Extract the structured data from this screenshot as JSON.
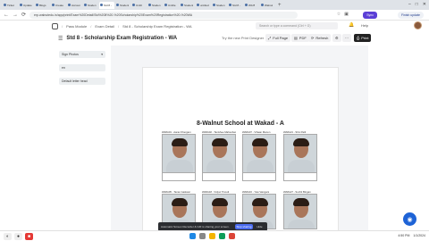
{
  "browser": {
    "tabs": [
      "Ticket",
      "Update",
      "Blogs",
      "Create",
      "Accoun",
      "Studen",
      "Std 8 -",
      "Student",
      "Untitl",
      "Studen",
      "Untitle",
      "Student",
      "untitled",
      "Studen",
      "Std 8 -",
      "WA B",
      "Walnut"
    ],
    "active_tab_index": 6,
    "url": "erp.walnutedu.in/app/print/Exam%20Detail/Std%208%20-%20Scholarship%20Exam%20Registration%20-%20WA",
    "sync_label": "Sync",
    "update_label": "Finish update"
  },
  "app_header": {
    "crumbs": [
      "Pass Module",
      "Exam Detail",
      "Std 8 - Scholarship Exam Registration - WA"
    ],
    "search_placeholder": "Search or type a command (Ctrl + G)",
    "help_label": "Help"
  },
  "title_bar": {
    "title": "Std 8 - Scholarship Exam Registration - WA",
    "try_view": "Try the new Print Designer",
    "full_page": "Full Page",
    "pdf": "PDF",
    "refresh": "Refresh",
    "print": "Print"
  },
  "side_panel": {
    "format": "Sign Photos",
    "language": "en",
    "letter_head": "Default letter head"
  },
  "document": {
    "school_title": "8-Walnut School at Wakad - A",
    "students_top": [
      {
        "caption": "WA8A01 - Aarav Khergam"
      },
      {
        "caption": "WA8A02 - Tanishee Maheshwar"
      },
      {
        "caption": "WA8A07 - Vihaan Manon"
      },
      {
        "caption": "WA8A21 - Shiv Patil"
      }
    ],
    "students_bottom": [
      {
        "caption": "WA8A05 - Tanav Gaikwar"
      },
      {
        "caption": "WA8A18 - Vidyut Trivedi"
      },
      {
        "caption": "WA8A16 - Yaw Vaingani"
      },
      {
        "caption": "WA8A27 - Suchit Bingan"
      }
    ]
  },
  "recorder": {
    "message": "Automatic Screen Recorder & GIF is sharing your screen.",
    "stop_label": "Stop sharing",
    "hide_label": "Hide"
  },
  "taskbar": {
    "time": "4:50 PM",
    "date": "1/1/2024"
  },
  "colors": {
    "accent": "#5b3fd6",
    "print_button": "#222222",
    "fab": "#1e63d6",
    "record": "#e53935"
  }
}
